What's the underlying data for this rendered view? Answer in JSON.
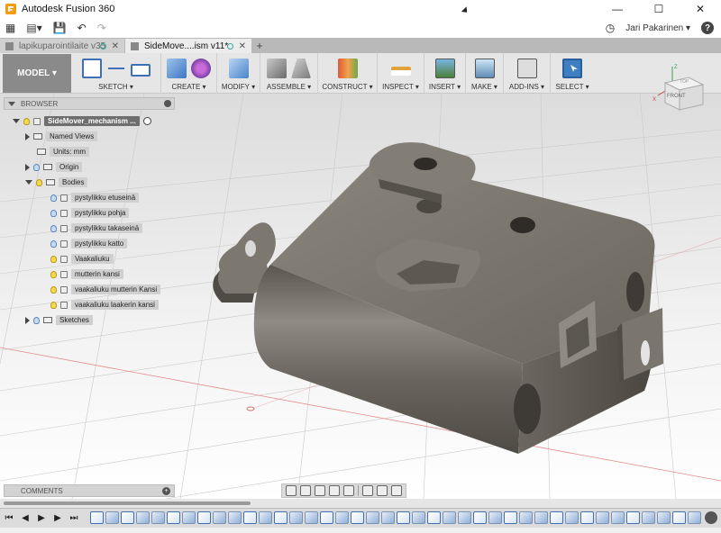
{
  "window": {
    "title": "Autodesk Fusion 360",
    "minimize": "—",
    "maximize": "☐",
    "close": "✕"
  },
  "qat": {
    "grid_menu": "▦",
    "file_menu": "▾",
    "save": "💾",
    "undo": "↶",
    "redo": "↷",
    "user_name": "Jari Pakarinen ▾",
    "help": "?"
  },
  "tabs": [
    {
      "label": "lapikuparointilaite v35",
      "active": false
    },
    {
      "label": "SideMove....ism v11*",
      "active": true
    }
  ],
  "ribbon": {
    "workspace": "MODEL ▾",
    "groups": [
      {
        "label": "SKETCH ▾"
      },
      {
        "label": "CREATE ▾"
      },
      {
        "label": "MODIFY ▾"
      },
      {
        "label": "ASSEMBLE ▾"
      },
      {
        "label": "CONSTRUCT ▾"
      },
      {
        "label": "INSPECT ▾"
      },
      {
        "label": "INSERT ▾"
      },
      {
        "label": "MAKE ▾"
      },
      {
        "label": "ADD-INS ▾"
      },
      {
        "label": "SELECT ▾"
      }
    ]
  },
  "viewcube": {
    "front": "FRONT",
    "top": "TOP",
    "axis_z": "Z",
    "axis_x": "X"
  },
  "browser": {
    "title": "BROWSER",
    "root": "SideMover_mechanism ...",
    "named_views": "Named Views",
    "units": "Units: mm",
    "origin": "Origin",
    "bodies_folder": "Bodies",
    "bodies": [
      "pystylikku etuseinä",
      "pystylikku pohja",
      "pystylikku takaseinä",
      "pystylikku katto",
      "Vaakaliuku",
      "mutterin kansi",
      "vaakaliuku mutterin Kansi",
      "vaakaliuku laakerin kansi"
    ],
    "sketches": "Sketches"
  },
  "comments": {
    "title": "COMMENTS",
    "add": "+"
  },
  "colors": {
    "ribbon_bg": "#e6e6e6",
    "workspace_bg": "#8a8a8a",
    "part_color": "#6f6b64",
    "accent_blue": "#3f6fb5"
  }
}
